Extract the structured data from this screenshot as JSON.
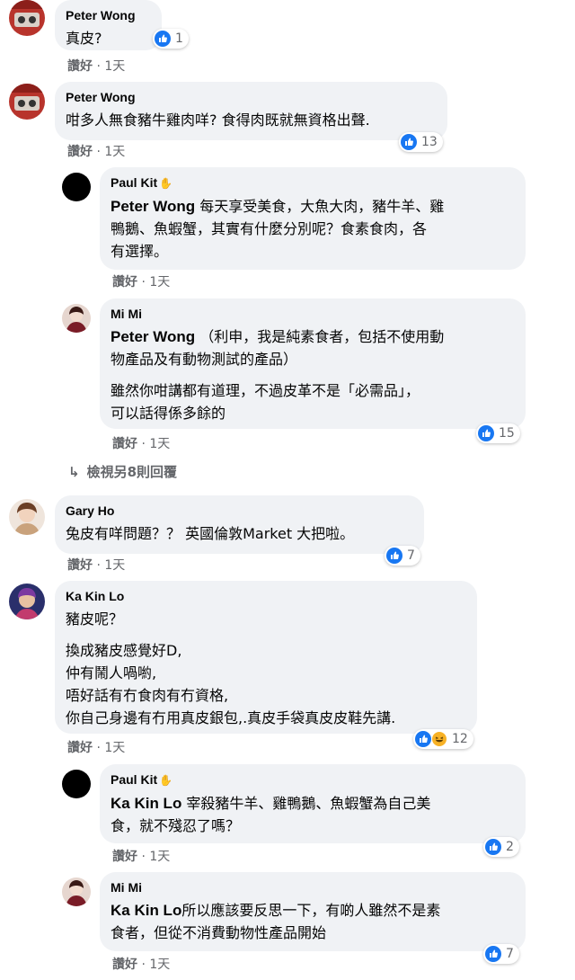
{
  "comments": [
    {
      "author": "Peter Wong",
      "text": "真皮?",
      "like_label": "讚好",
      "time": "1天",
      "reactions": "1"
    },
    {
      "author": "Peter Wong",
      "text": "咁多人無食豬牛雞肉咩? 食得肉既就無資格出聲.",
      "like_label": "讚好",
      "time": "1天",
      "reactions": "13"
    },
    {
      "author": "Paul Kit",
      "mention": "Peter Wong",
      "text_l1": " 每天享受美食，大魚大肉，豬牛羊、雞",
      "text_l2": "鴨鵝、魚蝦蟹，其實有什麼分別呢？食素食肉，各",
      "text_l3": "有選擇。",
      "like_label": "讚好",
      "time": "1天"
    },
    {
      "author": "Mi Mi",
      "mention": "Peter Wong",
      "text_l1": " （利申，我是純素食者，包括不使用動",
      "text_l2": "物產品及有動物測試的產品）",
      "p2_l1": "雖然你咁講都有道理，不過皮革不是「必需品」，",
      "p2_l2": "可以話得係多餘的",
      "like_label": "讚好",
      "time": "1天",
      "reactions": "15"
    },
    {
      "author": "Gary Ho",
      "text": "兔皮有咩問題？？ 英國倫敦Market 大把啦。",
      "like_label": "讚好",
      "time": "1天",
      "reactions": "7"
    },
    {
      "author": "Ka Kin Lo",
      "text": "豬皮呢？",
      "p2_l1": "換成豬皮感覺好D,",
      "p2_l2": "仲有鬧人喎喲,",
      "p2_l3": "唔好話有冇食肉有冇資格,",
      "p2_l4": "你自己身邊有冇用真皮銀包,.真皮手袋真皮皮鞋先講.",
      "like_label": "讚好",
      "time": "1天",
      "reactions": "12"
    },
    {
      "author": "Paul Kit",
      "mention": "Ka Kin Lo",
      "text_l1": " 宰殺豬牛羊、雞鴨鵝、魚蝦蟹為自己美",
      "text_l2": "食，就不殘忍了嗎？",
      "like_label": "讚好",
      "time": "1天",
      "reactions": "2"
    },
    {
      "author": "Mi Mi",
      "mention": "Ka Kin Lo",
      "text_l1": "所以應該要反思一下，有啲人雖然不是素",
      "text_l2": "食者，但從不消費動物性產品開始",
      "like_label": "讚好",
      "time": "1天",
      "reactions": "7"
    }
  ],
  "more_replies": "檢視另8則回覆",
  "sep": " · ",
  "colors": {
    "bubble": "#f0f2f5",
    "like": "#1877f2",
    "meta": "#65676b"
  }
}
